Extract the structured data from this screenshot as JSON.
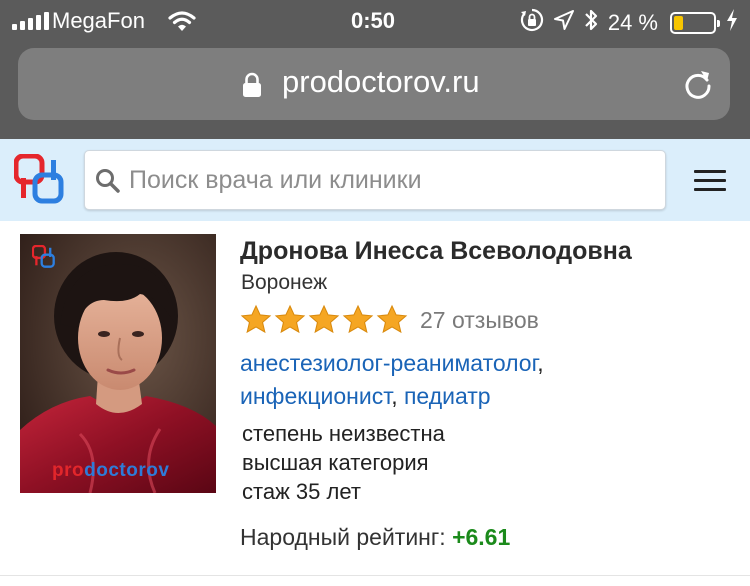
{
  "status_bar": {
    "carrier": "MegaFon",
    "time": "0:50",
    "battery_percent": "24 %",
    "battery_level": 0.24,
    "icons": [
      "signal-icon",
      "wifi-icon",
      "orientation-lock-icon",
      "location-arrow-icon",
      "bluetooth-icon",
      "battery-icon",
      "charging-icon"
    ]
  },
  "browser": {
    "url": "prodoctorov.ru",
    "icons": [
      "lock-icon",
      "reload-icon"
    ]
  },
  "header": {
    "search_placeholder": "Поиск врача или клиники",
    "icons": [
      "prodoctorov-logo",
      "search-icon",
      "hamburger-menu-icon"
    ]
  },
  "doctor": {
    "name": "Дронова Инесса Всеволодовна",
    "city": "Воронеж",
    "stars": 5,
    "reviews": "27 отзывов",
    "specialties": [
      "анестезиолог-реаниматолог",
      "инфекционист",
      "педиатр"
    ],
    "degree": "степень неизвестна",
    "category": "высшая категория",
    "experience": "стаж 35 лет",
    "rating_label": "Народный рейтинг:",
    "rating_value": "+6.61",
    "photo_watermark": {
      "part1": "pro",
      "part2": "doctorov"
    }
  },
  "colors": {
    "link": "#1a64b7",
    "rating_positive": "#1b8a1b",
    "header_bg": "#dbeefb",
    "star": "#f5a623"
  }
}
